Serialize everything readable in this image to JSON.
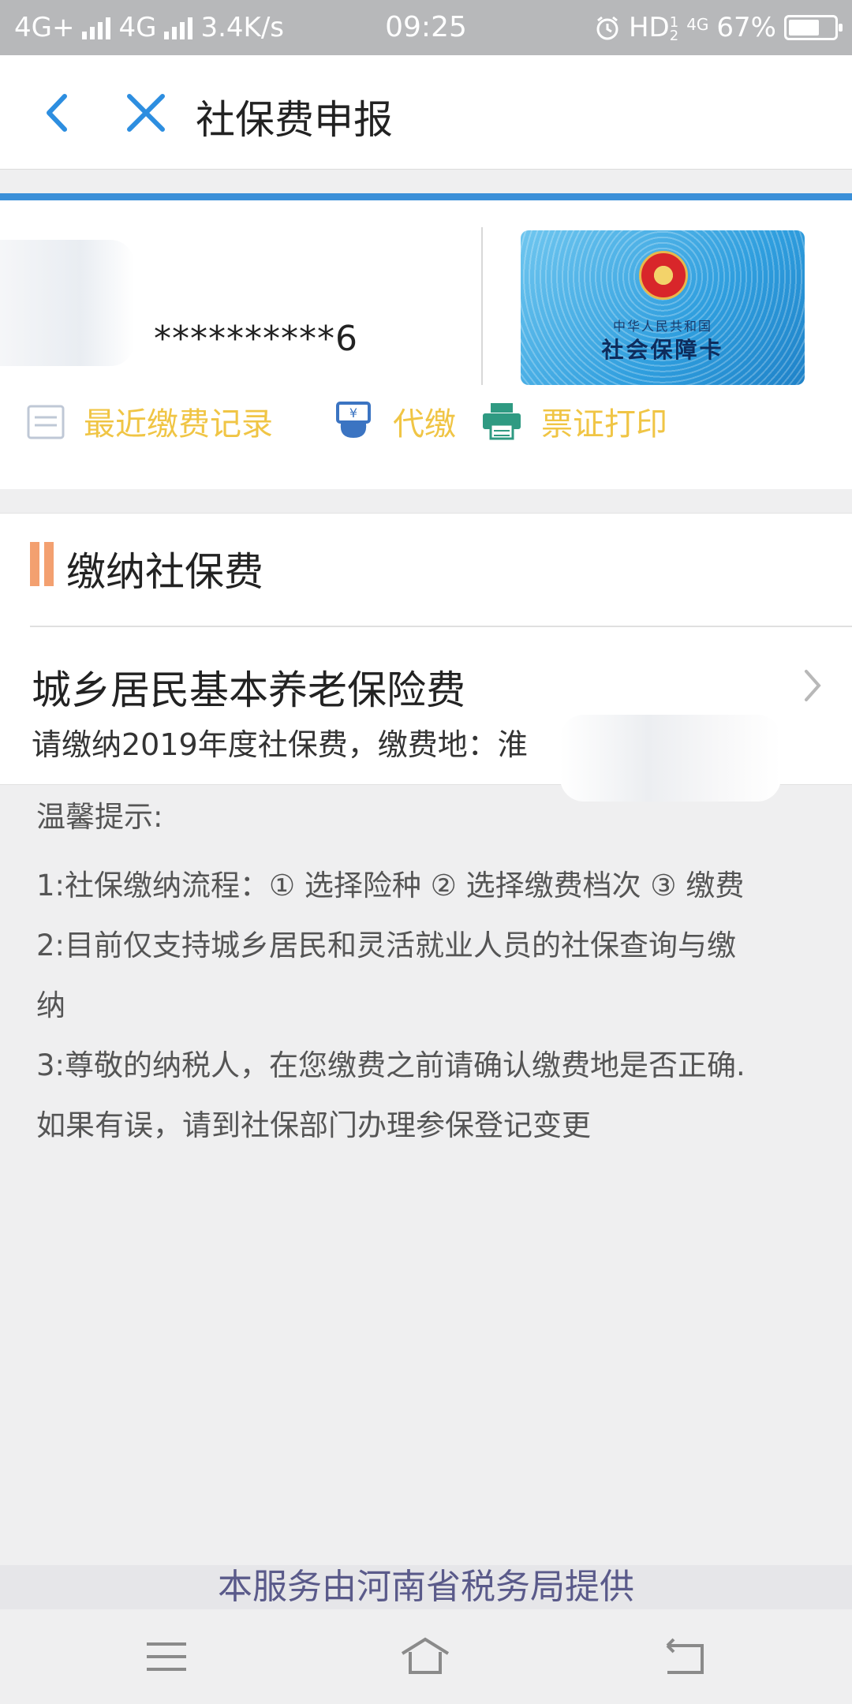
{
  "status_bar": {
    "net1": "4G+",
    "net2": "4G",
    "speed": "3.4K/s",
    "time": "09:25",
    "hd": "HD",
    "hd_sub_top": "1",
    "hd_sub_bottom": "2",
    "net3": "4G",
    "battery": "67%"
  },
  "nav": {
    "title": "社保费申报"
  },
  "info": {
    "masked_id": "**********6",
    "card": {
      "subtitle": "中华人民共和国",
      "title": "社会保障卡"
    },
    "quick_actions": [
      {
        "label": "最近缴费记录",
        "icon": "records-icon"
      },
      {
        "label": "代缴",
        "icon": "proxy-pay-icon"
      },
      {
        "label": "票证打印",
        "icon": "printer-icon"
      }
    ]
  },
  "pay_section": {
    "title": "缴纳社保费",
    "items": [
      {
        "name": "城乡居民基本养老保险费",
        "desc": "请缴纳2019年度社保费，缴费地：淮"
      }
    ]
  },
  "tips": {
    "title": "温馨提示:",
    "lines": [
      "1:社保缴纳流程：① 选择险种 ② 选择缴费档次 ③ 缴费",
      "2:目前仅支持城乡居民和灵活就业人员的社保查询与缴",
      "纳",
      "3:尊敬的纳税人，在您缴费之前请确认缴费地是否正确.",
      "如果有误，请到社保部门办理参保登记变更"
    ]
  },
  "footer": {
    "provider": "本服务由河南省税务局提供"
  },
  "colors": {
    "accent_blue": "#3a8fd8",
    "quick_action_text": "#f0c545",
    "section_bar": "#f3a070"
  }
}
